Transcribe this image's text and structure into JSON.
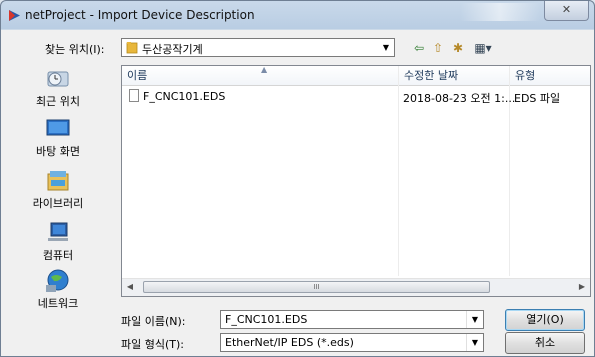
{
  "window": {
    "title": "netProject - Import Device Description",
    "close_label": "✕"
  },
  "lookin": {
    "label": "찾는 위치(I):",
    "value": "두산공작기계"
  },
  "toolbar": {
    "back_icon": "⇦",
    "up_icon": "⇧",
    "new_folder_icon": "✱",
    "view_icon": "▦▾"
  },
  "places": [
    {
      "label": "최근 위치",
      "icon": "recent-places-icon"
    },
    {
      "label": "바탕 화면",
      "icon": "desktop-icon"
    },
    {
      "label": "라이브러리",
      "icon": "libraries-icon"
    },
    {
      "label": "컴퓨터",
      "icon": "computer-icon"
    },
    {
      "label": "네트워크",
      "icon": "network-icon"
    }
  ],
  "filelist": {
    "columns": [
      "이름",
      "수정한 날짜",
      "유형"
    ],
    "rows": [
      {
        "name": "F_CNC101.EDS",
        "modified": "2018-08-23 오전 1:...",
        "type": "EDS 파일"
      }
    ],
    "scroll_grip": "III"
  },
  "form": {
    "filename_label": "파일 이름(N):",
    "filename_value": "F_CNC101.EDS",
    "filetype_label": "파일 형식(T):",
    "filetype_value": "EtherNet/IP EDS (*.eds)"
  },
  "buttons": {
    "open": "열기(O)",
    "cancel": "취소"
  },
  "colors": {
    "accent": "#3c7fb1",
    "folder": "#e8b73c"
  }
}
